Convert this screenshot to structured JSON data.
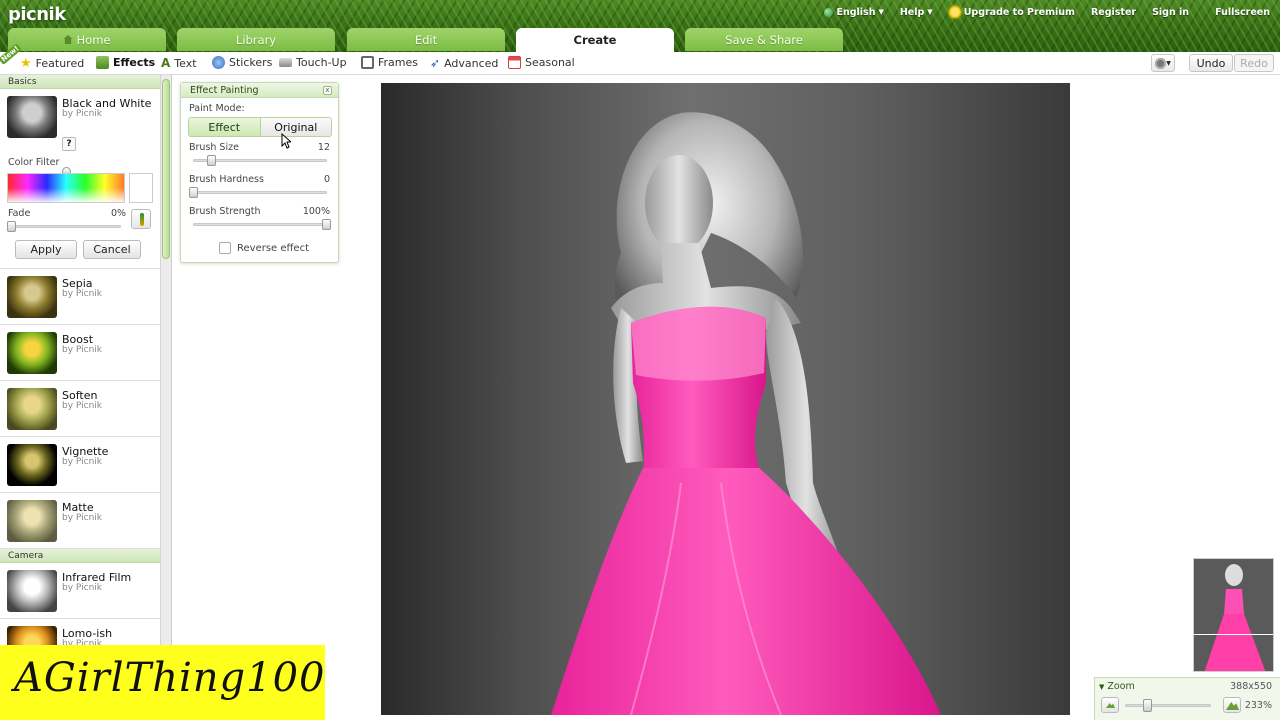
{
  "app": {
    "logo": "picnik"
  },
  "top_links": {
    "language": "English",
    "help": "Help",
    "upgrade": "Upgrade to Premium",
    "register": "Register",
    "sign_in": "Sign in",
    "fullscreen": "Fullscreen"
  },
  "tabs": [
    {
      "label": "Home",
      "icon": "home-icon"
    },
    {
      "label": "Library"
    },
    {
      "label": "Edit"
    },
    {
      "label": "Create",
      "active": true
    },
    {
      "label": "Save & Share"
    }
  ],
  "subtabs": {
    "new_badge": "New!",
    "featured": "Featured",
    "effects": "Effects",
    "text": "Text",
    "stickers": "Stickers",
    "touchup": "Touch-Up",
    "frames": "Frames",
    "advanced": "Advanced",
    "seasonal": "Seasonal",
    "undo": "Undo",
    "redo": "Redo"
  },
  "left_panel": {
    "basics_header": "Basics",
    "bw": {
      "name": "Black and White",
      "by": "by Picnik",
      "help": "?",
      "color_filter_label": "Color Filter",
      "fade_label": "Fade",
      "fade_value": "0%",
      "apply": "Apply",
      "cancel": "Cancel"
    },
    "effects": [
      {
        "name": "Sepia",
        "by": "by Picnik"
      },
      {
        "name": "Boost",
        "by": "by Picnik"
      },
      {
        "name": "Soften",
        "by": "by Picnik"
      },
      {
        "name": "Vignette",
        "by": "by Picnik"
      },
      {
        "name": "Matte",
        "by": "by Picnik"
      }
    ],
    "camera_header": "Camera",
    "camera_effects": [
      {
        "name": "Infrared Film",
        "by": "by Picnik"
      },
      {
        "name": "Lomo-ish",
        "by": "by Picnik"
      }
    ]
  },
  "painting_panel": {
    "title": "Effect Painting",
    "close": "x",
    "paint_mode_label": "Paint Mode:",
    "mode_effect": "Effect",
    "mode_original": "Original",
    "brush_size_label": "Brush Size",
    "brush_size_value": "12",
    "brush_hardness_label": "Brush Hardness",
    "brush_hardness_value": "0",
    "brush_strength_label": "Brush Strength",
    "brush_strength_value": "100%",
    "reverse_label": "Reverse effect"
  },
  "zoom": {
    "label": "Zoom",
    "dimensions": "388x550",
    "percent": "233%"
  },
  "watermark": {
    "text": "AGirlThing100"
  },
  "colors": {
    "tab_green": "#8cc856",
    "dress_pink": "#ff3fa8",
    "brand_green": "#3a7218"
  }
}
